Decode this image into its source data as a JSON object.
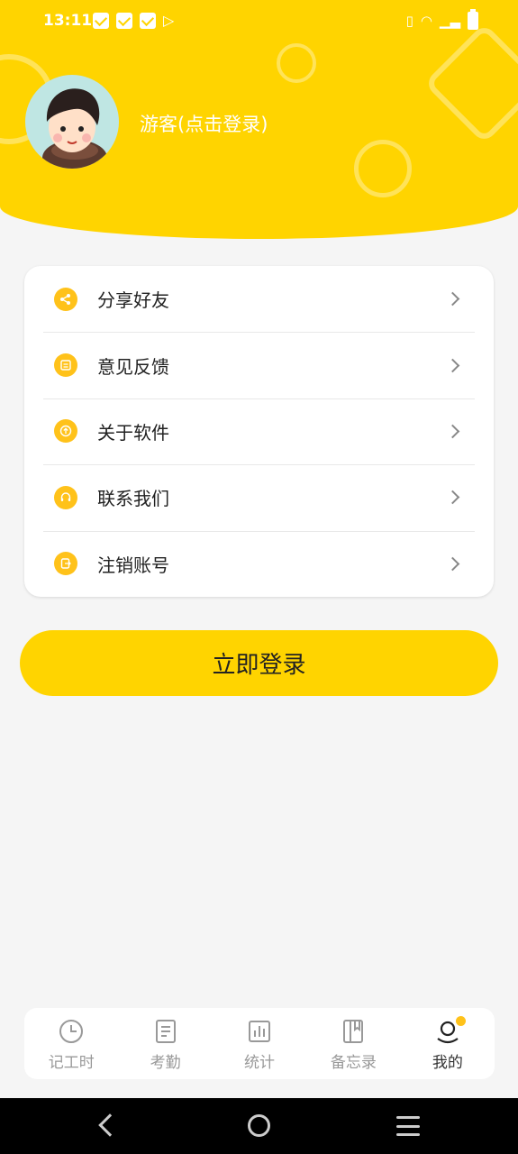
{
  "status_bar": {
    "time": "13:11"
  },
  "profile": {
    "name": "游客(点击登录)"
  },
  "menu": {
    "items": [
      {
        "label": "分享好友",
        "icon": "share-icon"
      },
      {
        "label": "意见反馈",
        "icon": "feedback-icon"
      },
      {
        "label": "关于软件",
        "icon": "about-icon"
      },
      {
        "label": "联系我们",
        "icon": "headset-icon"
      },
      {
        "label": "注销账号",
        "icon": "logout-icon"
      }
    ]
  },
  "login_button": {
    "label": "立即登录"
  },
  "tabbar": {
    "tabs": [
      {
        "label": "记工时",
        "icon": "clock-icon"
      },
      {
        "label": "考勤",
        "icon": "document-icon"
      },
      {
        "label": "统计",
        "icon": "bar-chart-icon"
      },
      {
        "label": "备忘录",
        "icon": "notebook-icon"
      },
      {
        "label": "我的",
        "icon": "profile-icon"
      }
    ],
    "active": "我的"
  },
  "colors": {
    "accent": "#FFD400",
    "icon_bg": "#FFC21A",
    "background": "#f5f5f5"
  }
}
